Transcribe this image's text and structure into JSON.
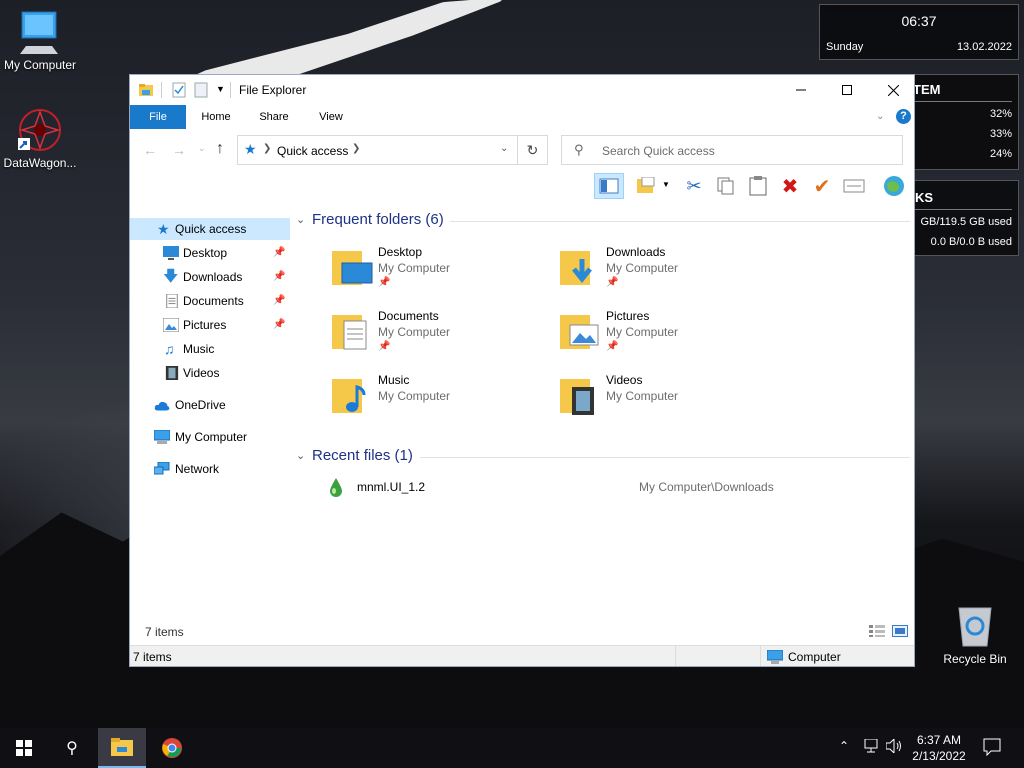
{
  "desktop": {
    "icons": [
      {
        "label": "My Computer"
      },
      {
        "label": "DataWagon..."
      },
      {
        "label": "Recycle Bin"
      }
    ]
  },
  "widget": {
    "clock": {
      "time": "06:37",
      "day": "Sunday",
      "date": "13.02.2022"
    },
    "system": {
      "header": "TEM",
      "values": [
        "32%",
        "33%",
        "24%"
      ]
    },
    "disks": {
      "header": "KS",
      "usage": "GB/119.5 GB used",
      "io": "0.0 B/0.0 B used"
    }
  },
  "window": {
    "title": "File Explorer",
    "tabs": [
      "File",
      "Home",
      "Share",
      "View"
    ],
    "address": {
      "location": "Quick access"
    },
    "search": {
      "placeholder": "Search Quick access"
    },
    "nav": {
      "quick_access": "Quick access",
      "pinned": [
        "Desktop",
        "Downloads",
        "Documents",
        "Pictures"
      ],
      "others": [
        "Music",
        "Videos"
      ],
      "onedrive": "OneDrive",
      "my_computer": "My Computer",
      "network": "Network"
    },
    "frequent": {
      "header": "Frequent folders (6)",
      "folders": [
        {
          "name": "Desktop",
          "location": "My Computer",
          "pinned": true
        },
        {
          "name": "Downloads",
          "location": "My Computer",
          "pinned": true
        },
        {
          "name": "Documents",
          "location": "My Computer",
          "pinned": true
        },
        {
          "name": "Pictures",
          "location": "My Computer",
          "pinned": true
        },
        {
          "name": "Music",
          "location": "My Computer",
          "pinned": false
        },
        {
          "name": "Videos",
          "location": "My Computer",
          "pinned": false
        }
      ]
    },
    "recent": {
      "header": "Recent files (1)",
      "files": [
        {
          "name": "mnml.UI_1.2",
          "path": "My Computer\\Downloads"
        }
      ]
    },
    "status": {
      "items": "7 items",
      "items_bottom": "7 items",
      "location": "Computer"
    }
  },
  "taskbar": {
    "time": "6:37 AM",
    "date": "2/13/2022"
  },
  "colors": {
    "accent": "#1979ca",
    "selection": "#cce8ff",
    "group_header": "#1e3287",
    "folder": "#f5c84a"
  }
}
